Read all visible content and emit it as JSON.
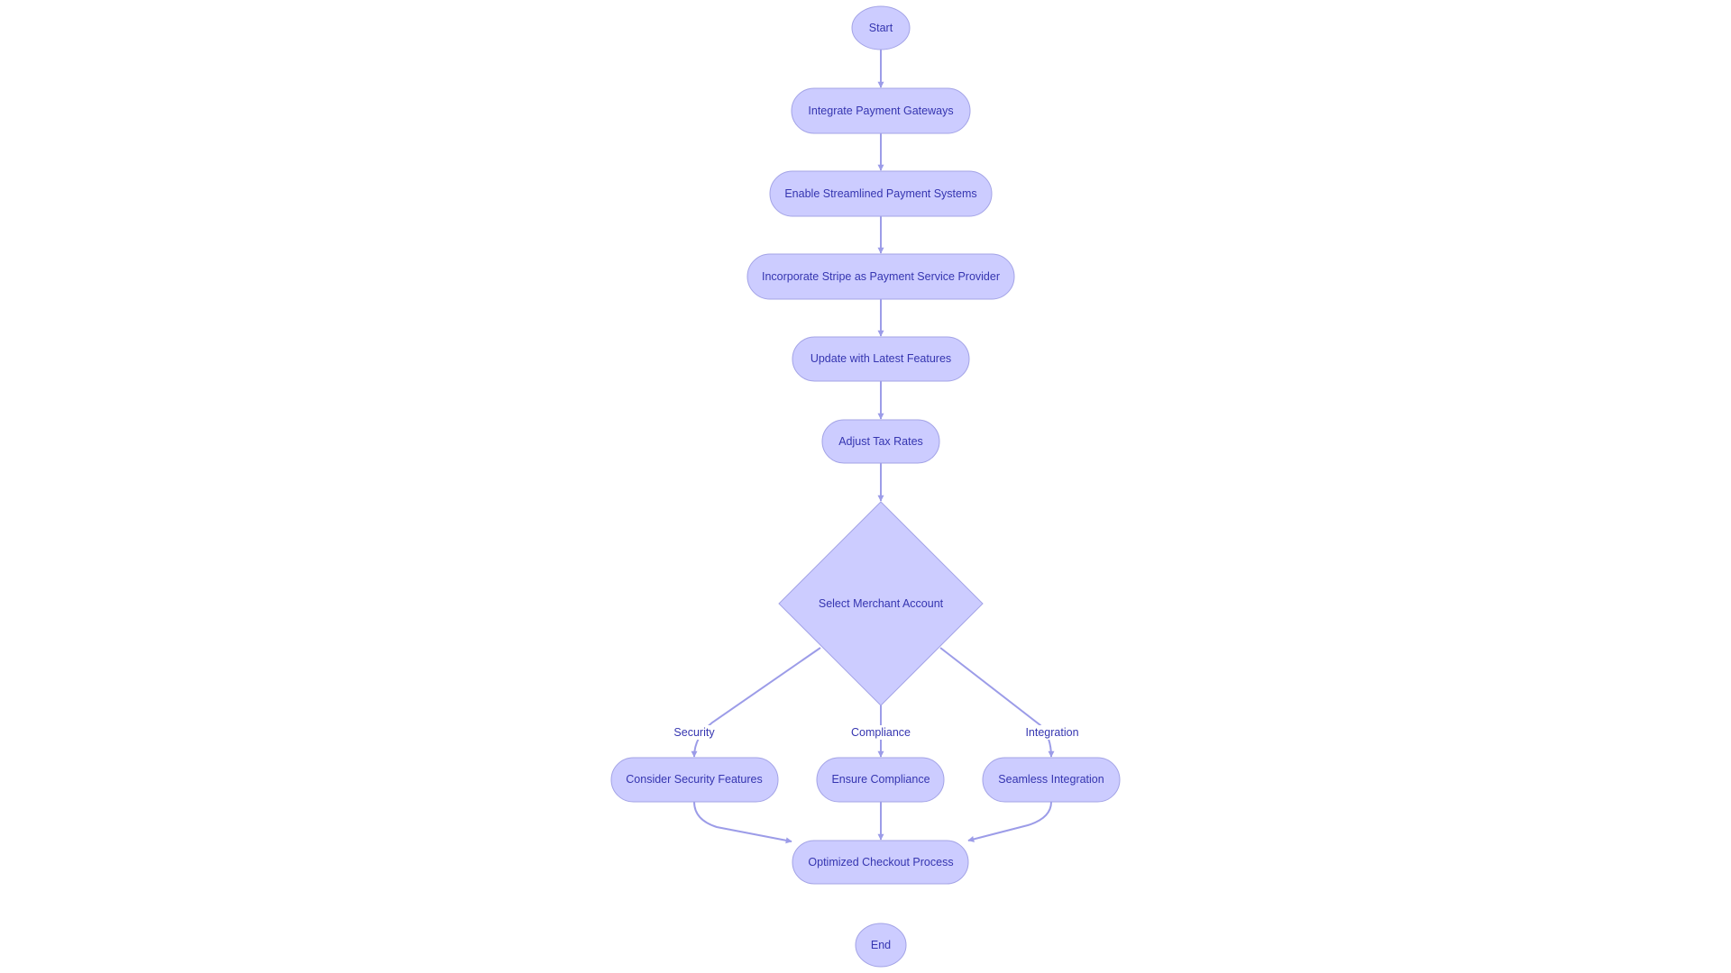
{
  "diagram": {
    "type": "flowchart",
    "direction": "top-down",
    "colors": {
      "node_fill": "#CCCCFF",
      "node_stroke": "#A3A3E6",
      "text": "#3535B0",
      "edge": "#9C9CE8"
    },
    "nodes": [
      {
        "id": "start",
        "label": "Start",
        "shape": "circle"
      },
      {
        "id": "integrate",
        "label": "Integrate Payment Gateways",
        "shape": "stadium"
      },
      {
        "id": "enable",
        "label": "Enable Streamlined Payment Systems",
        "shape": "stadium"
      },
      {
        "id": "stripe",
        "label": "Incorporate Stripe as Payment Service Provider",
        "shape": "stadium"
      },
      {
        "id": "update",
        "label": "Update with Latest Features",
        "shape": "stadium"
      },
      {
        "id": "tax",
        "label": "Adjust Tax Rates",
        "shape": "stadium"
      },
      {
        "id": "merchant",
        "label": "Select Merchant Account",
        "shape": "diamond"
      },
      {
        "id": "security",
        "label": "Consider Security Features",
        "shape": "stadium"
      },
      {
        "id": "compliance",
        "label": "Ensure Compliance",
        "shape": "stadium"
      },
      {
        "id": "integration",
        "label": "Seamless Integration",
        "shape": "stadium"
      },
      {
        "id": "checkout",
        "label": "Optimized Checkout Process",
        "shape": "stadium"
      },
      {
        "id": "end",
        "label": "End",
        "shape": "circle"
      }
    ],
    "edges": [
      {
        "from": "start",
        "to": "integrate",
        "label": ""
      },
      {
        "from": "integrate",
        "to": "enable",
        "label": ""
      },
      {
        "from": "enable",
        "to": "stripe",
        "label": ""
      },
      {
        "from": "stripe",
        "to": "update",
        "label": ""
      },
      {
        "from": "update",
        "to": "tax",
        "label": ""
      },
      {
        "from": "tax",
        "to": "merchant",
        "label": ""
      },
      {
        "from": "merchant",
        "to": "security",
        "label": "Security"
      },
      {
        "from": "merchant",
        "to": "compliance",
        "label": "Compliance"
      },
      {
        "from": "merchant",
        "to": "integration",
        "label": "Integration"
      },
      {
        "from": "security",
        "to": "checkout",
        "label": ""
      },
      {
        "from": "compliance",
        "to": "checkout",
        "label": ""
      },
      {
        "from": "integration",
        "to": "checkout",
        "label": ""
      },
      {
        "from": "checkout",
        "to": "end",
        "label": ""
      }
    ]
  }
}
